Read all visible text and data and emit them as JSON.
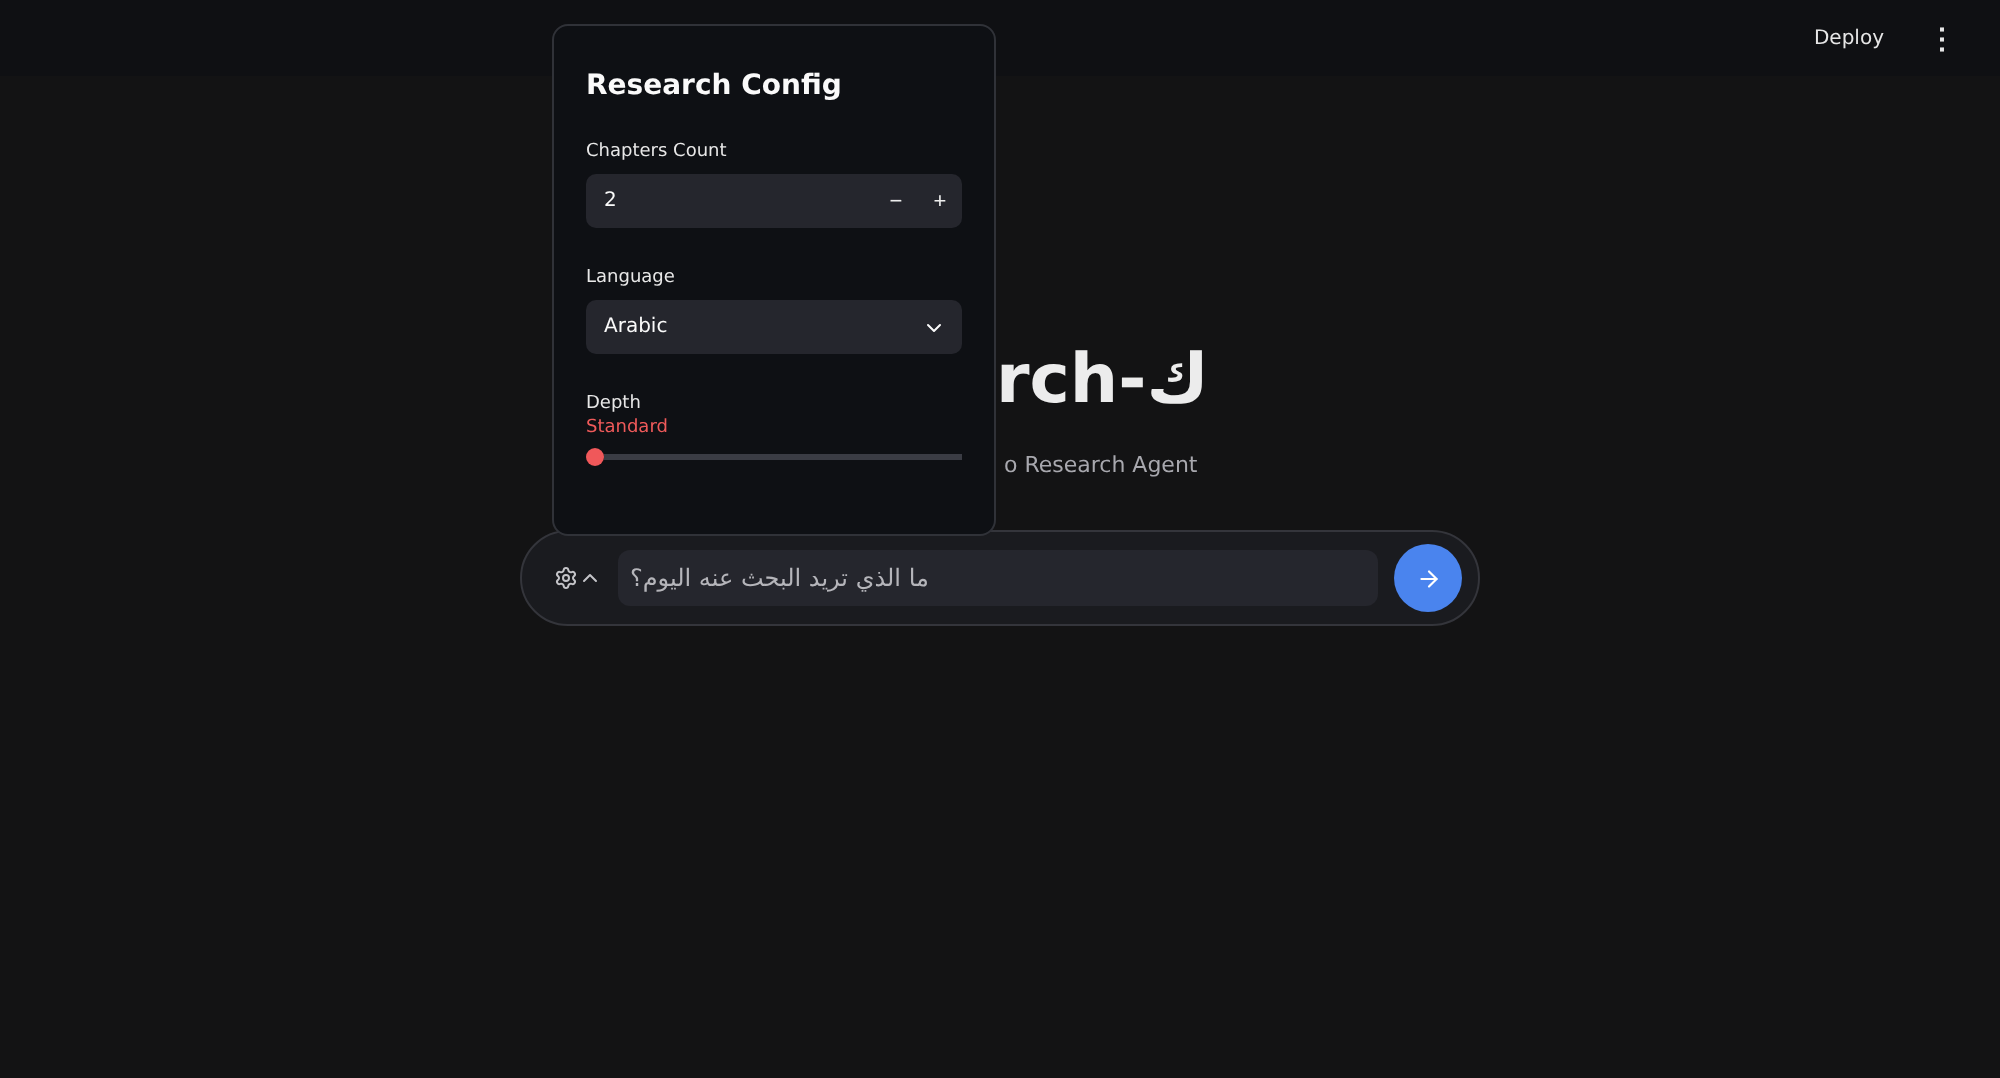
{
  "header": {
    "deploy": "Deploy",
    "menu": "⋮"
  },
  "hero": {
    "title": "rch-ك",
    "subtitle": "o Research Agent"
  },
  "chat": {
    "placeholder": "ما الذي تريد البحث عنه اليوم؟",
    "settings_expanded": true
  },
  "popover": {
    "title": "Research Config",
    "fields": [
      {
        "kind": "number",
        "label": "Chapters Count",
        "value": "2",
        "minus": "−",
        "plus": "+"
      },
      {
        "kind": "select",
        "label": "Language",
        "value": "Arabic"
      },
      {
        "kind": "slider",
        "label": "Depth",
        "value": "Standard",
        "level": 0
      }
    ]
  }
}
